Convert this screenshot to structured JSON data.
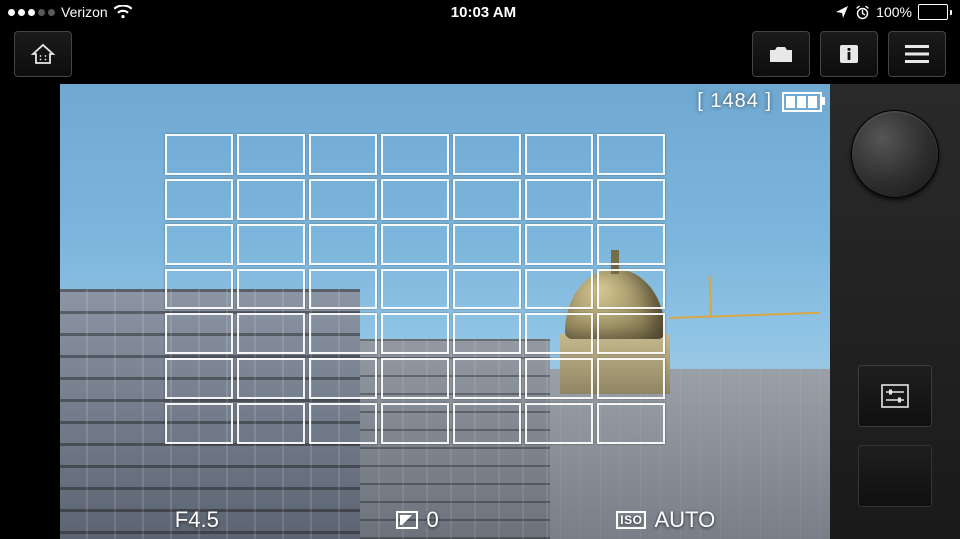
{
  "status": {
    "signal_strength": 3,
    "carrier": "Verizon",
    "time": "10:03 AM",
    "battery_percent": "100%"
  },
  "viewfinder": {
    "shots_remaining": "[ 1484 ]",
    "aperture": "F4.5",
    "ev_value": "0",
    "iso_label": "ISO",
    "iso_value": "AUTO"
  },
  "icons": {
    "home": "home-icon",
    "camera": "camera-icon",
    "info": "info-icon",
    "menu": "menu-icon",
    "sliders": "sliders-icon",
    "wifi": "wifi-icon",
    "location": "location-arrow-icon",
    "alarm": "alarm-clock-icon"
  }
}
